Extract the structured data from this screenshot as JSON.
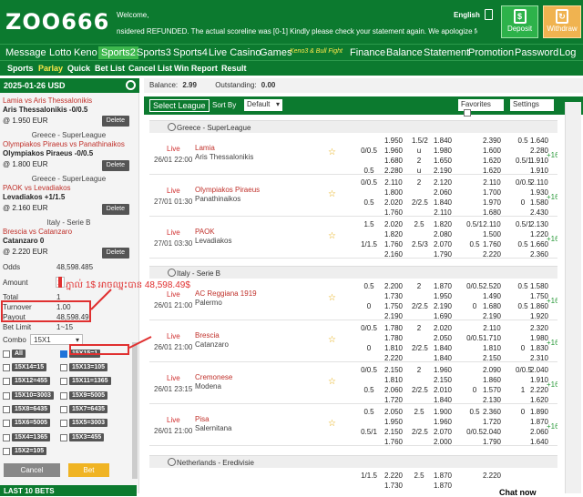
{
  "header": {
    "logo": "ZOO666",
    "welcome": "Welcome,",
    "ticker": "nsidered REFUNDED. The actual scoreline was [0-1] Kindly please check your statement again. We apologize for the inconvenience",
    "lang": "English",
    "deposit": "Deposit",
    "withdraw": "Withdraw"
  },
  "nav": [
    "Message",
    "Lotto",
    "Keno",
    "Sports2",
    "Sports3",
    "Sports4",
    "Live Casino",
    "Games",
    "Keno3 & Bull Fight",
    "Finance",
    "Balance",
    "Statement",
    "Promotion",
    "Password",
    "Log"
  ],
  "subnav": [
    "Sports",
    "Parlay",
    "Quick",
    "Bet List",
    "Cancel List",
    "Win Report",
    "Result"
  ],
  "left": {
    "date": "2025-01-26 USD",
    "bets": [
      {
        "teams": "Lamia vs Aris Thessalonikis",
        "pick": "Aris Thessalonikis -0/0.5",
        "odds": "@ 1.950 EUR",
        "del": "Delete"
      },
      {
        "league": "Greece - SuperLeague",
        "teams": "Olympiakos Piraeus vs Panathinaikos",
        "pick": "Olympiakos Piraeus -0/0.5",
        "odds": "@ 1.800 EUR",
        "del": "Delete"
      },
      {
        "league": "Greece - SuperLeague",
        "teams": "PAOK vs Levadiakos",
        "pick": "Levadiakos +1/1.5",
        "odds": "@ 2.160 EUR",
        "del": "Delete"
      },
      {
        "league": "Italy - Serie B",
        "teams": "Brescia vs Catanzaro",
        "pick": "Catanzaro 0",
        "odds": "@ 2.220 EUR",
        "del": "Delete"
      }
    ],
    "odds_label": "Odds",
    "odds_val": "48,598.485",
    "amount_label": "Amount",
    "amount_val": "1",
    "annot": "ភ្នាល់ 1$ អាចឈ្នះបាន 48,598.49$",
    "total_label": "Total",
    "total_val": "1",
    "turnover_label": "Turnover",
    "turnover_val": "1.00",
    "payout_label": "Payout",
    "payout_val": "48,598.49",
    "betlimit_label": "Bet Limit",
    "betlimit_val": "1~15",
    "combo_label": "Combo",
    "combo_val": "15X1",
    "combos": [
      [
        "All",
        "15X15=1"
      ],
      [
        "15X14=15",
        "15X13=105"
      ],
      [
        "15X12=455",
        "15X11=1365"
      ],
      [
        "15X10=3003",
        "15X9=5005"
      ],
      [
        "15X8=6435",
        "15X7=6435"
      ],
      [
        "15X6=5005",
        "15X5=3003"
      ],
      [
        "15X4=1365",
        "15X3=455"
      ],
      [
        "15X2=105",
        ""
      ]
    ],
    "cancel": "Cancel",
    "bet": "Bet",
    "lastbets": "LAST 10 BETS"
  },
  "main": {
    "balance_label": "Balance:",
    "balance": "2.99",
    "outstanding_label": "Outstanding:",
    "outstanding": "0.00",
    "select_league": "Select League",
    "sort_label": "Sort By",
    "sort_val": "Default",
    "fav": "Favorites",
    "settings": "Settings",
    "leagues": [
      "Greece - SuperLeague",
      "Italy - Serie B",
      "Netherlands - Eredivisie"
    ],
    "matches": [
      {
        "time": "26/01 22:00",
        "home": "Lamia",
        "away": "Aris Thessalonikis",
        "rows": [
          [
            "",
            "1.950",
            "1.5/2",
            "1.840",
            "",
            "2.390",
            "0.5",
            "1.640"
          ],
          [
            "0/0.5",
            "1.960",
            "u",
            "1.980",
            "",
            "1.600",
            "",
            "2.280"
          ],
          [
            "",
            "1.680",
            "2",
            "1.650",
            "",
            "1.620",
            "0.5/1",
            "1.910"
          ],
          [
            "0.5",
            "2.280",
            "u",
            "2.190",
            "",
            "1.620",
            "",
            "1.910"
          ]
        ],
        "more": "+16"
      },
      {
        "time": "27/01 01:30",
        "home": "Olympiakos Piraeus",
        "away": "Panathinaikos",
        "rows": [
          [
            "0/0.5",
            "2.110",
            "2",
            "2.120",
            "",
            "2.110",
            "0/0.5",
            "2.110"
          ],
          [
            "",
            "1.800",
            "",
            "2.060",
            "",
            "1.700",
            "",
            "1.930"
          ],
          [
            "0.5",
            "2.020",
            "2/2.5",
            "1.840",
            "",
            "1.970",
            "0",
            "1.580"
          ],
          [
            "",
            "1.760",
            "",
            "2.110",
            "",
            "1.680",
            "",
            "2.430"
          ]
        ],
        "more": "+16"
      },
      {
        "time": "27/01 03:30",
        "home": "PAOK",
        "away": "Levadiakos",
        "rows": [
          [
            "1.5",
            "2.020",
            "2.5",
            "1.820",
            "0.5/1",
            "2.110",
            "0.5/1",
            "2.130"
          ],
          [
            "",
            "1.820",
            "",
            "2.080",
            "",
            "1.500",
            "",
            "1.220"
          ],
          [
            "1/1.5",
            "1.760",
            "2.5/3",
            "2.070",
            "0.5",
            "1.760",
            "0.5",
            "1.660"
          ],
          [
            "",
            "2.160",
            "",
            "1.790",
            "",
            "2.220",
            "",
            "2.360"
          ]
        ],
        "more": "+16"
      },
      {
        "time": "26/01 21:00",
        "home": "AC Reggiana 1919",
        "away": "Palermo",
        "rows": [
          [
            "0.5",
            "2.200",
            "2",
            "1.870",
            "0/0.5",
            "2.520",
            "0.5",
            "1.580"
          ],
          [
            "",
            "1.730",
            "",
            "1.950",
            "",
            "1.490",
            "",
            "1.750"
          ],
          [
            "0",
            "1.750",
            "2/2.5",
            "2.190",
            "0",
            "1.680",
            "0.5",
            "1.860"
          ],
          [
            "",
            "2.190",
            "",
            "1.690",
            "",
            "2.190",
            "",
            "1.920"
          ]
        ],
        "more": "+16"
      },
      {
        "time": "26/01 21:00",
        "home": "Brescia",
        "away": "Catanzaro",
        "rows": [
          [
            "0/0.5",
            "1.780",
            "2",
            "2.020",
            "",
            "2.110",
            "",
            "2.320"
          ],
          [
            "",
            "1.780",
            "",
            "2.050",
            "0/0.5",
            "1.710",
            "",
            "1.980"
          ],
          [
            "0",
            "1.810",
            "2/2.5",
            "1.840",
            "",
            "1.810",
            "0",
            "1.830"
          ],
          [
            "",
            "2.220",
            "",
            "1.840",
            "",
            "2.150",
            "",
            "2.310"
          ]
        ],
        "more": "+16"
      },
      {
        "time": "26/01 23:15",
        "home": "Cremonese",
        "away": "Modena",
        "rows": [
          [
            "0/0.5",
            "2.150",
            "2",
            "1.960",
            "",
            "2.090",
            "0/0.5",
            "2.040"
          ],
          [
            "",
            "1.810",
            "",
            "2.150",
            "",
            "1.860",
            "",
            "1.910"
          ],
          [
            "0.5",
            "2.060",
            "2/2.5",
            "2.010",
            "0",
            "1.570",
            "1",
            "2.220"
          ],
          [
            "",
            "1.720",
            "",
            "1.840",
            "",
            "2.130",
            "",
            "1.620"
          ]
        ],
        "more": "+16"
      },
      {
        "time": "26/01 21:00",
        "home": "Pisa",
        "away": "Salernitana",
        "rows": [
          [
            "0.5",
            "2.050",
            "2.5",
            "1.900",
            "0.5",
            "2.360",
            "0",
            "1.890"
          ],
          [
            "",
            "1.950",
            "",
            "1.960",
            "",
            "1.720",
            "",
            "1.870"
          ],
          [
            "0.5/1",
            "2.150",
            "2/2.5",
            "2.070",
            "0/0.5",
            "2.040",
            "",
            "2.060"
          ],
          [
            "",
            "1.760",
            "",
            "2.000",
            "",
            "1.790",
            "",
            "1.640"
          ]
        ],
        "more": "+16"
      }
    ],
    "ned_rows": [
      [
        "1/1.5",
        "2.220",
        "2.5",
        "1.870",
        "",
        "2.220",
        "",
        ""
      ],
      [
        "",
        "1.730",
        "",
        "1.870",
        "",
        "",
        "",
        ""
      ]
    ],
    "live": "Live"
  },
  "chat": "Chat now"
}
